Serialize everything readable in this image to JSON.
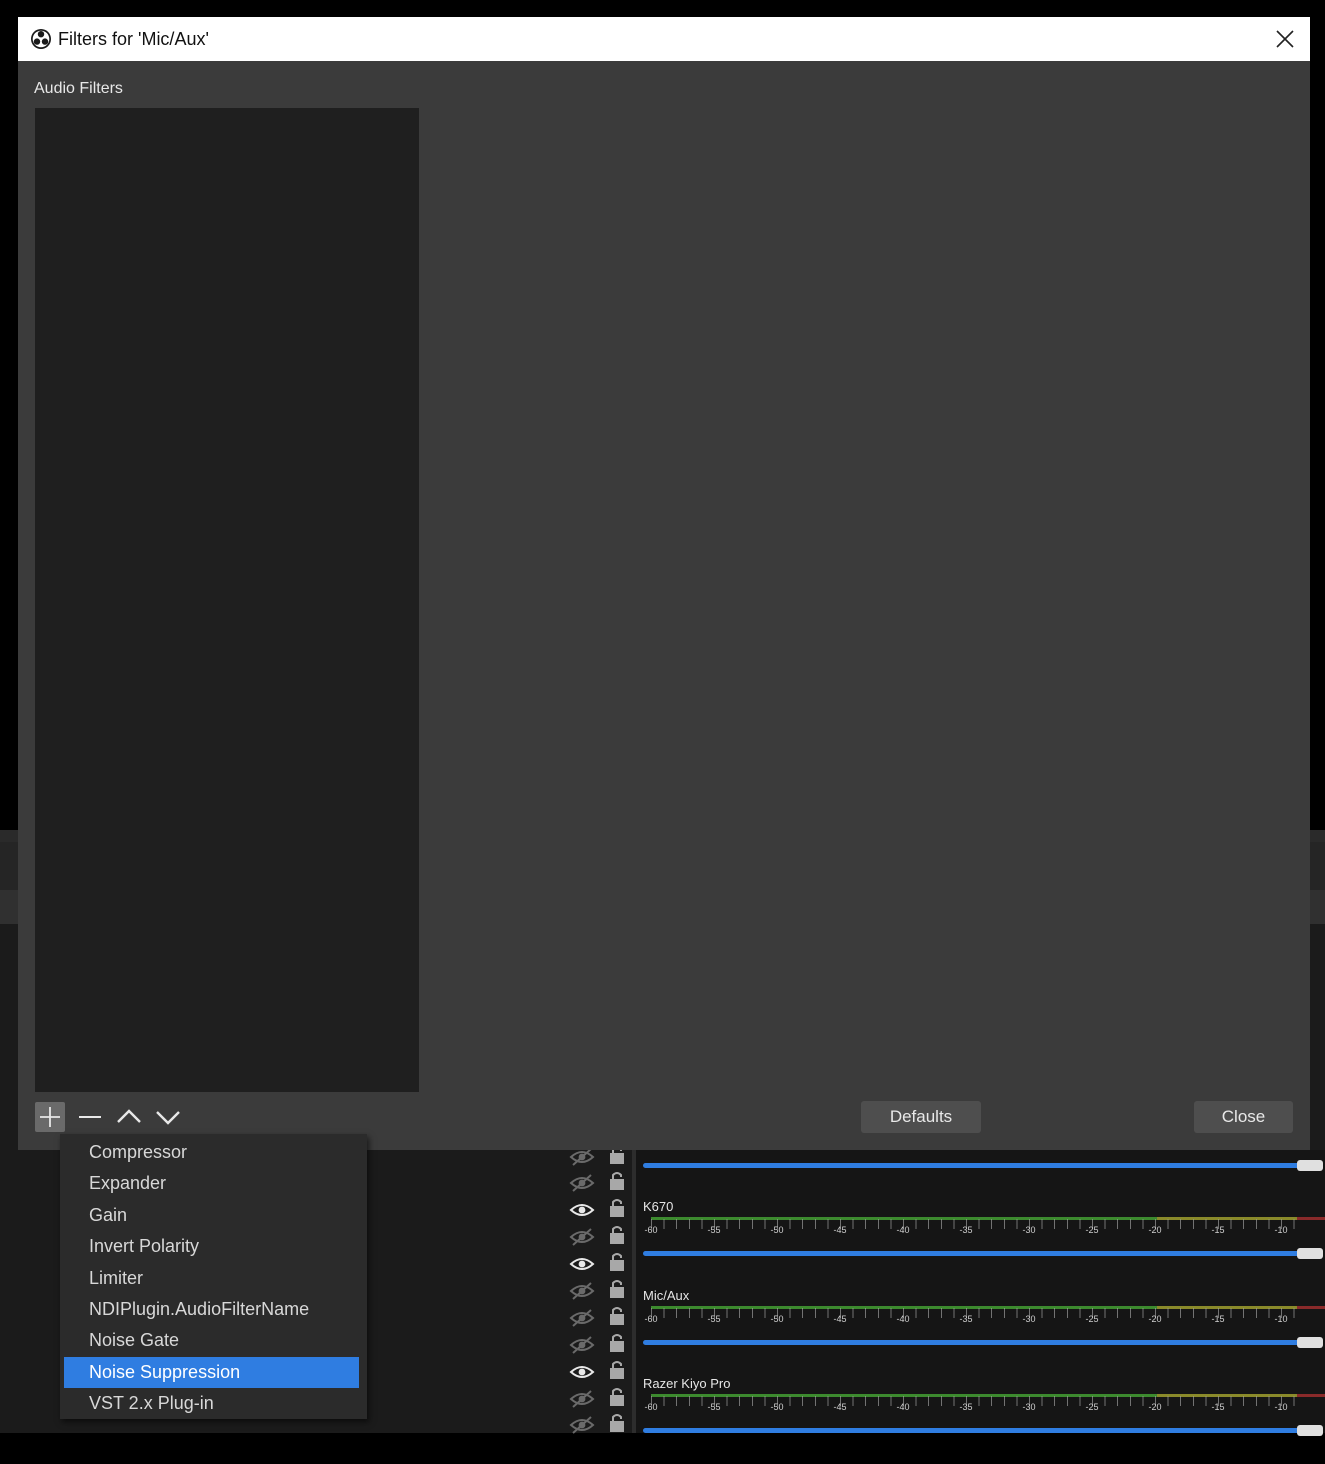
{
  "dialog": {
    "title": "Filters for 'Mic/Aux'",
    "section_label": "Audio Filters",
    "defaults_label": "Defaults",
    "close_label": "Close"
  },
  "toolbar": {
    "add_icon": "plus-icon",
    "remove_icon": "minus-icon",
    "up_icon": "chevron-up-icon",
    "down_icon": "chevron-down-icon"
  },
  "add_menu": {
    "items": [
      "Compressor",
      "Expander",
      "Gain",
      "Invert Polarity",
      "Limiter",
      "NDIPlugin.AudioFilterName",
      "Noise Gate",
      "Noise Suppression",
      "VST 2.x Plug-in"
    ],
    "selected": "Noise Suppression"
  },
  "mixer": {
    "channels": [
      {
        "name": "K670"
      },
      {
        "name": "Mic/Aux"
      },
      {
        "name": "Razer Kiyo Pro"
      }
    ],
    "scale": [
      "-60",
      "-55",
      "-50",
      "-45",
      "-40",
      "-35",
      "-30",
      "-25",
      "-20",
      "-15",
      "-10"
    ]
  },
  "colors": {
    "accent": "#2f7de1",
    "dialog_bg": "#3b3b3b",
    "list_bg": "#1f1f1f",
    "meter_green": "#3c8a2e",
    "meter_yellow": "#8a8a2a",
    "meter_red": "#8a2a2a"
  }
}
